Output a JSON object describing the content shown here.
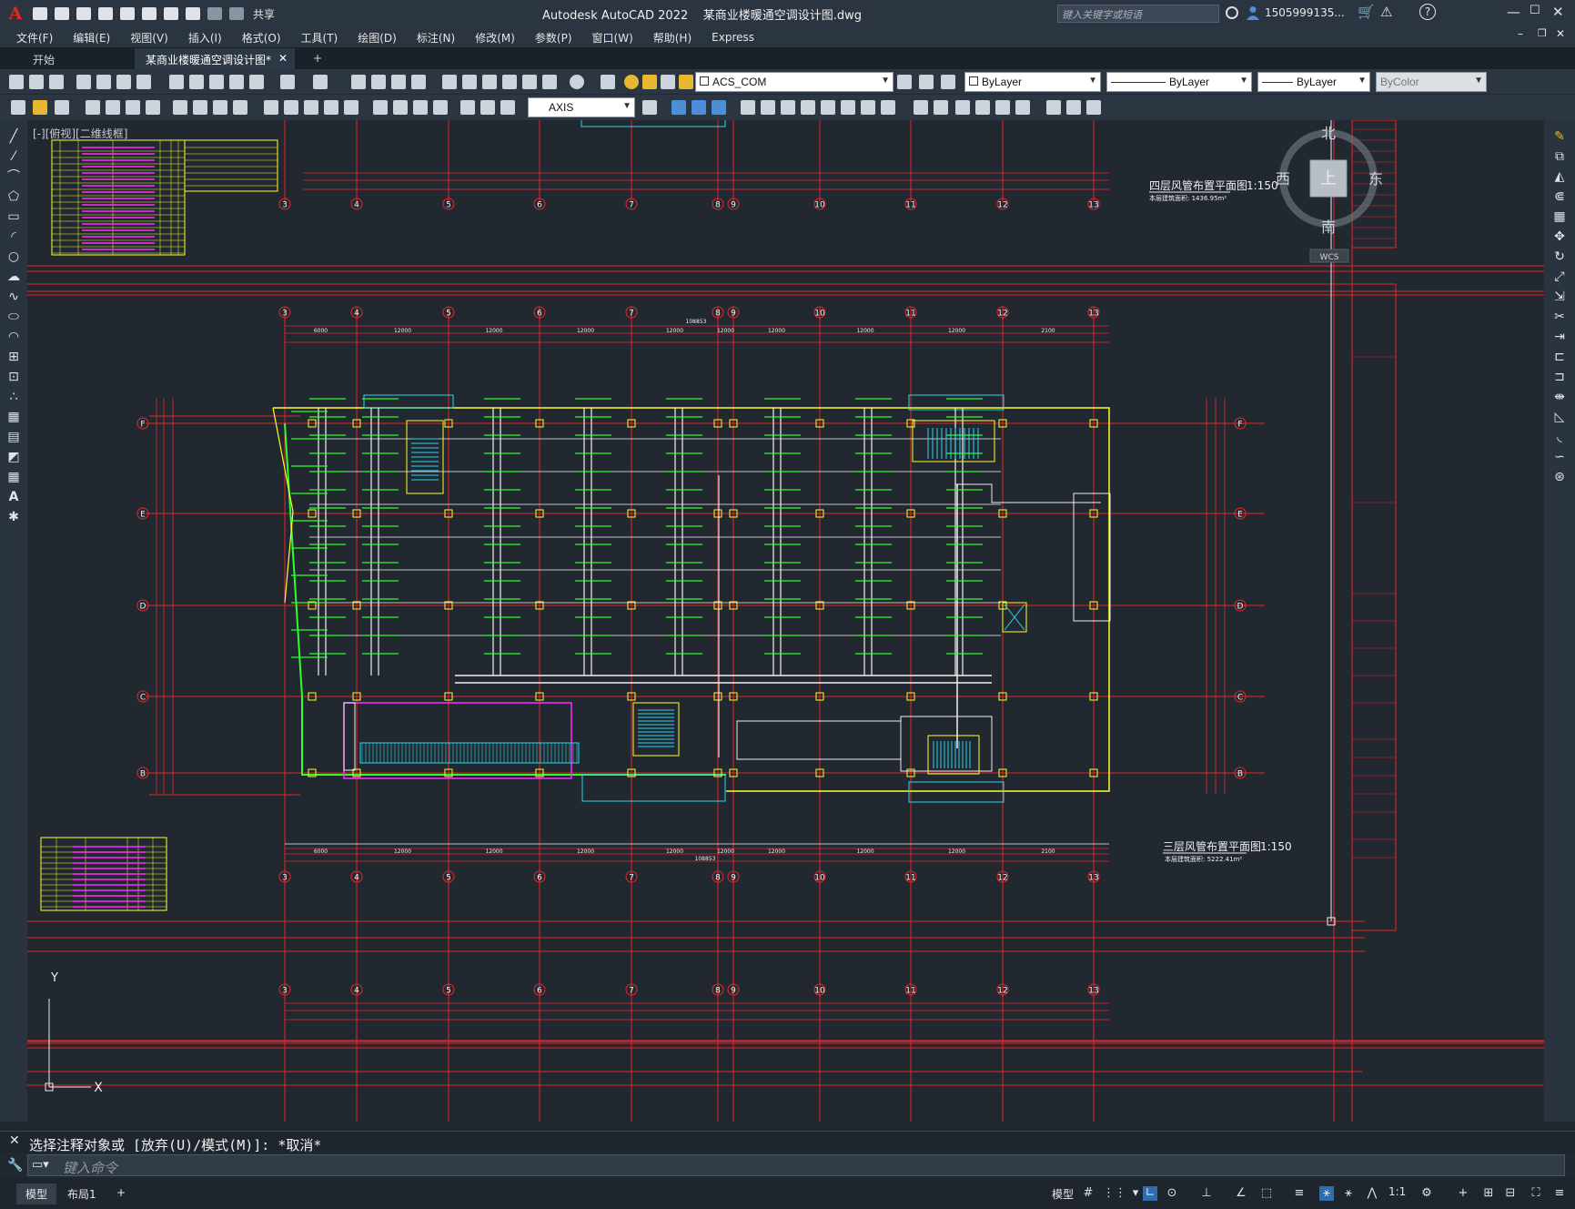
{
  "titlebar": {
    "app_name": "Autodesk AutoCAD 2022",
    "file_name": "某商业楼暖通空调设计图.dwg",
    "share_label": "共享",
    "search_placeholder": "键入关键字或短语",
    "user": "1505999135..."
  },
  "menu": [
    "文件(F)",
    "编辑(E)",
    "视图(V)",
    "插入(I)",
    "格式(O)",
    "工具(T)",
    "绘图(D)",
    "标注(N)",
    "修改(M)",
    "参数(P)",
    "窗口(W)",
    "帮助(H)",
    "Express"
  ],
  "tabs": {
    "start": "开始",
    "drawing": "某商业楼暖通空调设计图*",
    "add": "+"
  },
  "toolbar": {
    "layer": "ACS_COM",
    "color": "ByLayer",
    "linetype": "ByLayer",
    "lineweight": "ByLayer",
    "plotstyle": "ByColor",
    "dimstyle": "AXIS"
  },
  "viewport_label": "[-][俯视][二维线框]",
  "viewcube": {
    "north": "北",
    "south": "南",
    "east": "东",
    "west": "西",
    "top": "上",
    "wcs": "WCS"
  },
  "drawing": {
    "plan_upper_title": "四层风管布置平面图",
    "plan_upper_scale": "1:150",
    "plan_upper_area": "本层建筑面积: 1436.95m²",
    "plan_lower_title": "三层风管布置平面图",
    "plan_lower_scale": "1:150",
    "plan_lower_area": "本层建筑面积: 5222.41m²",
    "axis_numbers": [
      "3",
      "4",
      "5",
      "6",
      "7",
      "8",
      "9",
      "10",
      "11",
      "12",
      "13"
    ],
    "axis_letters": [
      "F",
      "E",
      "D",
      "C",
      "B"
    ],
    "dim_segments": [
      "6000",
      "12000",
      "12000",
      "12000",
      "12000",
      "12000",
      "12000",
      "12000",
      "12000",
      "2100"
    ],
    "dim_total": "108853"
  },
  "ucs": {
    "x": "X",
    "y": "Y"
  },
  "command": {
    "history": "选择注释对象或 [放弃(U)/模式(M)]: *取消*",
    "placeholder": "键入命令"
  },
  "status": {
    "model_tab": "模型",
    "layout_tab": "布局1",
    "add": "+",
    "model_space": "模型",
    "scale": "1:1"
  },
  "colors": {
    "red": "#e8262a",
    "green": "#2dff2d",
    "yellow": "#ffff2a",
    "cyan": "#2ad6e8",
    "magenta": "#ff2aff",
    "white": "#f0f0f0"
  }
}
